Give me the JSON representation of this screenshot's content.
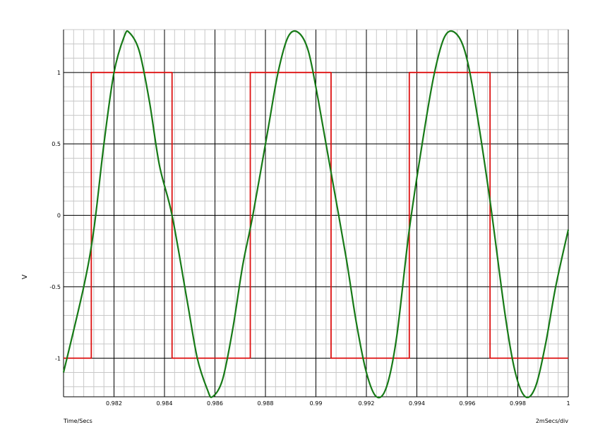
{
  "chart_data": {
    "type": "line",
    "title": "",
    "xlabel": "Time/Secs",
    "ylabel": "V",
    "x_scale_note": "2mSecs/div",
    "xlim": [
      0.98,
      1.0
    ],
    "ylim": [
      -1.27,
      1.3
    ],
    "grid": true,
    "x_ticks": [
      0.982,
      0.984,
      0.986,
      0.988,
      0.99,
      0.992,
      0.994,
      0.996,
      0.998,
      1
    ],
    "x_tick_labels": [
      "0.982",
      "0.984",
      "0.986",
      "0.988",
      "0.99",
      "0.992",
      "0.994",
      "0.996",
      "0.998",
      "1"
    ],
    "y_ticks": [
      1,
      0.5,
      0,
      -0.5,
      -1
    ],
    "y_tick_labels": [
      "1",
      "0.5",
      "0",
      "-0.5",
      "-1"
    ],
    "series": [
      {
        "color": "#dd1111",
        "x": [
          0.98,
          0.9811,
          0.9811,
          0.9843,
          0.9843,
          0.9874,
          0.9874,
          0.9906,
          0.9906,
          0.9937,
          0.9937,
          0.9969,
          0.9969,
          1.0
        ],
        "y": [
          -1,
          -1,
          1,
          1,
          -1,
          -1,
          1,
          1,
          -1,
          -1,
          1,
          1,
          -1,
          -1
        ]
      },
      {
        "color": "#177a17",
        "x": [
          0.98,
          0.9808,
          0.9812,
          0.9816,
          0.982,
          0.9824,
          0.9826,
          0.983,
          0.9834,
          0.9838,
          0.9843,
          0.9849,
          0.9853,
          0.9857,
          0.9859,
          0.9863,
          0.9867,
          0.9871,
          0.9875,
          0.9881,
          0.9885,
          0.9889,
          0.9893,
          0.9897,
          0.9901,
          0.9906,
          0.9912,
          0.9916,
          0.992,
          0.9924,
          0.9928,
          0.9932,
          0.9937,
          0.9943,
          0.9947,
          0.9951,
          0.9955,
          0.9959,
          0.9963,
          0.9969,
          0.9975,
          0.9979,
          0.9983,
          0.9987,
          0.9991,
          0.9995,
          1.0
        ],
        "y": [
          -1.1,
          -0.5,
          -0.1,
          0.5,
          1.0,
          1.25,
          1.28,
          1.15,
          0.8,
          0.35,
          0.0,
          -0.6,
          -1.0,
          -1.22,
          -1.27,
          -1.15,
          -0.8,
          -0.35,
          0.0,
          0.6,
          1.0,
          1.25,
          1.28,
          1.15,
          0.8,
          0.3,
          -0.3,
          -0.75,
          -1.1,
          -1.27,
          -1.2,
          -0.85,
          -0.1,
          0.6,
          1.0,
          1.25,
          1.28,
          1.15,
          0.8,
          0.1,
          -0.7,
          -1.1,
          -1.27,
          -1.2,
          -0.9,
          -0.5,
          -0.1
        ]
      }
    ]
  }
}
